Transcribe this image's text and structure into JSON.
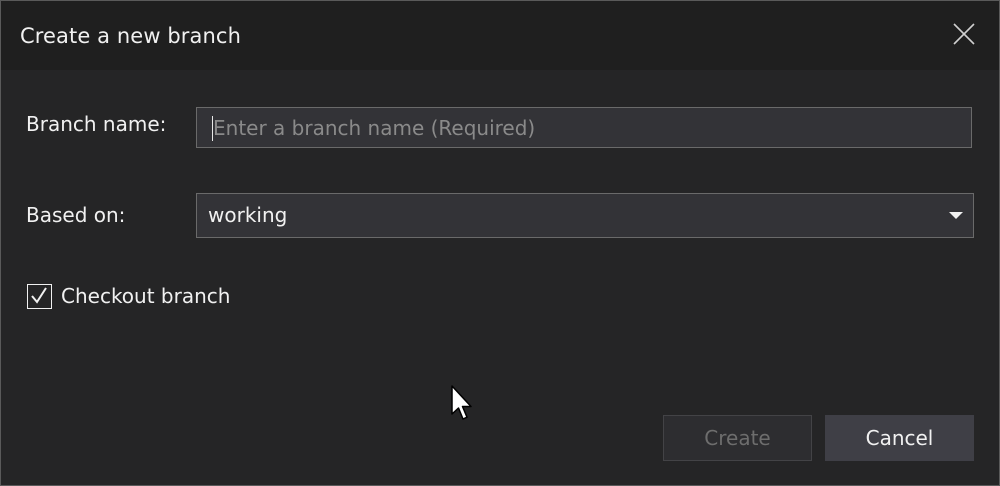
{
  "dialog": {
    "title": "Create a new branch",
    "close_icon": "close-icon"
  },
  "form": {
    "branch_name_label": "Branch name:",
    "branch_name_value": "",
    "branch_name_placeholder": "Enter a branch name (Required)",
    "based_on_label": "Based on:",
    "based_on_value": "working",
    "based_on_icon": "chevron-down-icon",
    "checkout_label": "Checkout branch",
    "checkout_checked": true
  },
  "buttons": {
    "create_label": "Create",
    "create_enabled": false,
    "cancel_label": "Cancel"
  },
  "colors": {
    "background": "#252526",
    "titlebar": "#1f1f1f",
    "input_background": "#333337",
    "input_border": "#6a6a6a",
    "text": "#f1f1f1",
    "placeholder": "#8a8a8a",
    "disabled_text": "#6d6d6d",
    "cancel_button": "#3f3f46"
  }
}
